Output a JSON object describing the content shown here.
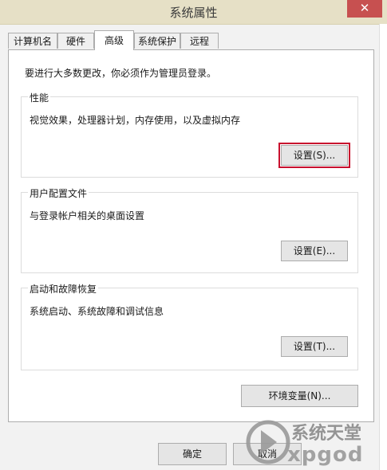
{
  "window": {
    "title": "系统属性",
    "close_label": "✕"
  },
  "tabs": [
    {
      "label": "计算机名",
      "active": false
    },
    {
      "label": "硬件",
      "active": false
    },
    {
      "label": "高级",
      "active": true
    },
    {
      "label": "系统保护",
      "active": false
    },
    {
      "label": "远程",
      "active": false
    }
  ],
  "notice": "要进行大多数更改，你必须作为管理员登录。",
  "groups": {
    "performance": {
      "title": "性能",
      "desc": "视觉效果，处理器计划，内存使用，以及虚拟内存",
      "button": "设置(S)..."
    },
    "profiles": {
      "title": "用户配置文件",
      "desc": "与登录帐户相关的桌面设置",
      "button": "设置(E)..."
    },
    "startup": {
      "title": "启动和故障恢复",
      "desc": "系统启动、系统故障和调试信息",
      "button": "设置(T)..."
    }
  },
  "env_button": "环境变量(N)...",
  "footer": {
    "ok": "确定",
    "cancel": "取消"
  },
  "watermark": {
    "name": "系统天堂",
    "sub": "xpgod"
  }
}
